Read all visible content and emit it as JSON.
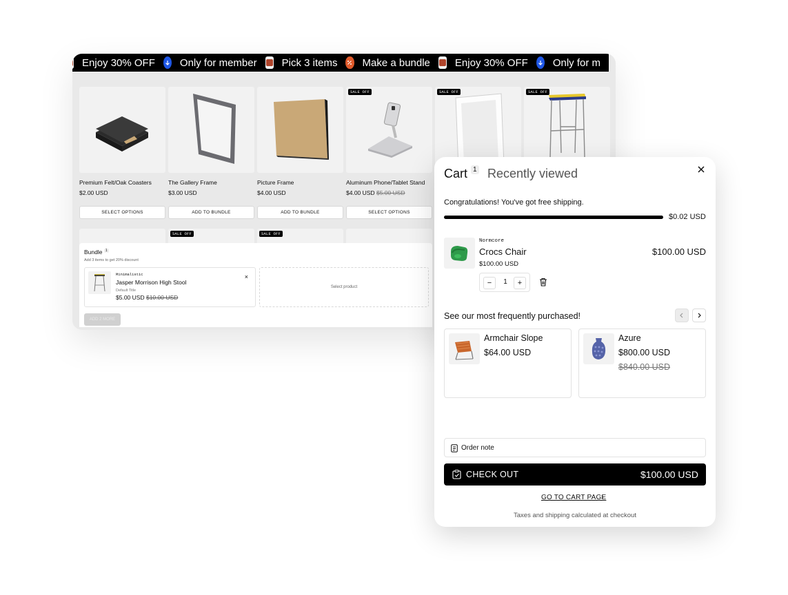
{
  "marquee": [
    {
      "kind": "thumb",
      "icon": "product-thumb-icon"
    },
    {
      "kind": "text",
      "text": "Enjoy 30% OFF"
    },
    {
      "kind": "dot",
      "icon": "arrow-down-icon",
      "color": "#1f57e6"
    },
    {
      "kind": "text",
      "text": "Only for member"
    },
    {
      "kind": "thumb",
      "icon": "product-thumb-icon"
    },
    {
      "kind": "text",
      "text": "Pick 3 items"
    },
    {
      "kind": "dot",
      "icon": "percent-icon",
      "color": "#e05a2b"
    },
    {
      "kind": "text",
      "text": "Make a bundle"
    },
    {
      "kind": "thumb",
      "icon": "product-thumb-icon"
    },
    {
      "kind": "text",
      "text": "Enjoy 30% OFF"
    },
    {
      "kind": "dot",
      "icon": "arrow-down-icon",
      "color": "#1f57e6"
    },
    {
      "kind": "text",
      "text": "Only for m"
    }
  ],
  "products": [
    {
      "title": "Premium Felt/Oak Coasters",
      "price": "$2.00 USD",
      "compare": "",
      "button": "SELECT OPTIONS",
      "badge": "",
      "icon": "coasters-icon"
    },
    {
      "title": "The Gallery Frame",
      "price": "$3.00 USD",
      "compare": "",
      "button": "ADD TO BUNDLE",
      "badge": "",
      "icon": "gallery-frame-icon"
    },
    {
      "title": "Picture Frame",
      "price": "$4.00 USD",
      "compare": "",
      "button": "ADD TO BUNDLE",
      "badge": "",
      "icon": "picture-frame-icon"
    },
    {
      "title": "Aluminum Phone/Tablet Stand",
      "price": "$4.00 USD",
      "compare": "$5.00 USD",
      "button": "SELECT OPTIONS",
      "badge": "SALE OFF",
      "icon": "phone-stand-icon"
    },
    {
      "title": "",
      "price": "",
      "compare": "",
      "button": "",
      "badge": "SALE OFF",
      "icon": "white-frame-icon"
    },
    {
      "title": "",
      "price": "",
      "compare": "",
      "button": "",
      "badge": "SALE OFF",
      "icon": "stool-icon"
    }
  ],
  "row2_badges": [
    "",
    "SALE OFF",
    "SALE OFF",
    ""
  ],
  "bundle": {
    "title": "Bundle",
    "count": "1",
    "subtitle": "Add 3 items to get 20% discount",
    "item": {
      "brand": "Minimalistic",
      "name": "Jasper Morrison High Stool",
      "variant": "Default Title",
      "price": "$5.00 USD",
      "compare": "$10.00 USD"
    },
    "slot_label": "Select product",
    "button": "ADD 2 MORE"
  },
  "cart": {
    "tab_cart": "Cart",
    "count": "1",
    "tab_recent": "Recently viewed",
    "shipping_message": "Congratulations! You've got free shipping.",
    "shipping_amount": "$0.02 USD",
    "shipping_progress": 1.0,
    "line_item": {
      "brand": "Normcore",
      "name": "Crocs Chair",
      "unit_price": "$100.00 USD",
      "total": "$100.00 USD",
      "quantity": "1"
    },
    "fbt_title": "See our most frequently purchased!",
    "recommendations": [
      {
        "name": "Armchair Slope",
        "price": "$64.00 USD",
        "compare": ""
      },
      {
        "name": "Azure",
        "price": "$800.00 USD",
        "compare": "$840.00 USD"
      }
    ],
    "order_note": "Order note",
    "checkout_label": "CHECK OUT",
    "checkout_total": "$100.00 USD",
    "cart_link": "GO TO CART PAGE",
    "taxes_note": "Taxes and shipping calculated at checkout"
  }
}
